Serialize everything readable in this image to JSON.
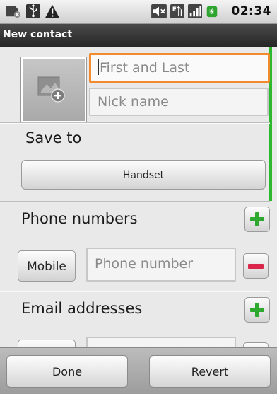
{
  "statusbar": {
    "time": "02:34",
    "icons": [
      "sim-warning-icon",
      "usb-icon",
      "alert-triangle-icon",
      "mute-icon",
      "data-arrows-icon",
      "signal-icon",
      "battery-icon"
    ]
  },
  "titlebar": {
    "title": "New contact"
  },
  "name_section": {
    "name_placeholder": "First and Last",
    "nickname_placeholder": "Nick name"
  },
  "save_to": {
    "label": "Save to",
    "button": "Handset"
  },
  "phone": {
    "label": "Phone numbers",
    "type": "Mobile",
    "placeholder": "Phone number"
  },
  "email": {
    "label": "Email addresses"
  },
  "footer": {
    "done": "Done",
    "revert": "Revert"
  },
  "colors": {
    "focus": "#f28a2e",
    "add": "#2ea82e",
    "remove": "#d9264a",
    "accent": "#2eb82e"
  }
}
